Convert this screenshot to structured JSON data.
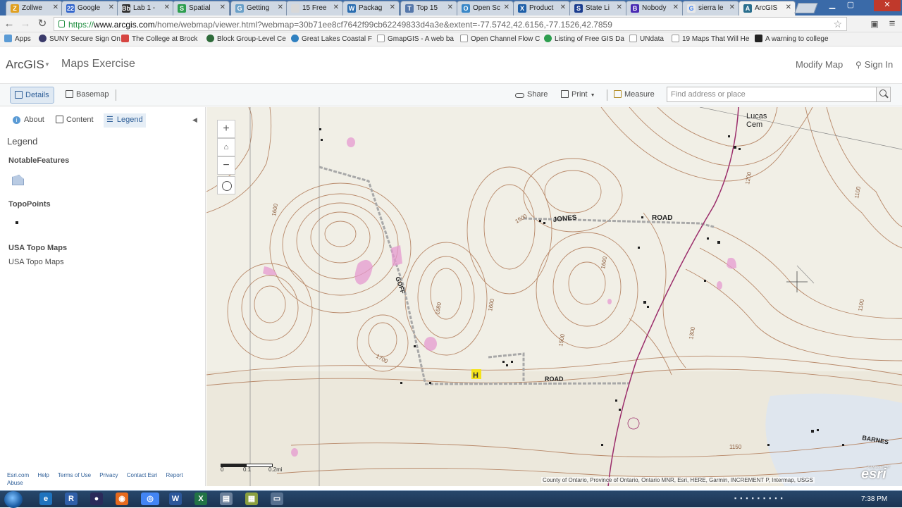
{
  "browser": {
    "tabs": [
      {
        "title": "Zollwe",
        "fav": "Z",
        "color": "#e0a020"
      },
      {
        "title": "Google",
        "fav": "22",
        "color": "#3366cc"
      },
      {
        "title": "Lab 1 -",
        "fav": "Bb",
        "color": "#333333"
      },
      {
        "title": "Spatial",
        "fav": "S",
        "color": "#2e9e4f"
      },
      {
        "title": "Getting",
        "fav": "G",
        "color": "#6aa0c8"
      },
      {
        "title": "15 Free",
        "fav": "",
        "color": "#d8d8d8"
      },
      {
        "title": "Packag",
        "fav": "W",
        "color": "#2a6db0"
      },
      {
        "title": "Top 15",
        "fav": "T",
        "color": "#5577aa"
      },
      {
        "title": "Open Sc",
        "fav": "O",
        "color": "#3a88c8"
      },
      {
        "title": "Product",
        "fav": "X",
        "color": "#1e5fa8"
      },
      {
        "title": "State Li",
        "fav": "S",
        "color": "#1b3d8f"
      },
      {
        "title": "Nobody",
        "fav": "B",
        "color": "#4b2bb3"
      },
      {
        "title": "sierra le",
        "fav": "G",
        "color": "#e8e8e8"
      },
      {
        "title": "ArcGIS",
        "fav": "A",
        "color": "#2b6f8e"
      }
    ],
    "url": {
      "scheme": "https://",
      "host": "www.arcgis.com",
      "path": "/home/webmap/viewer.html?webmap=30b71ee8cf7642f99cb62249833d4a3e&extent=-77.5742,42.6156,-77.1526,42.7859"
    },
    "bookmarks": [
      {
        "label": "Apps",
        "color": "#5b9bd5"
      },
      {
        "label": "SUNY Secure Sign On",
        "color": "#3a3a6a"
      },
      {
        "label": "The College at Brock",
        "color": "#d64541"
      },
      {
        "label": "Block Group-Level Ce",
        "color": "#2e6b3a"
      },
      {
        "label": "Great Lakes Coastal F",
        "color": "#2f80c0"
      },
      {
        "label": "GmapGIS - A web ba",
        "color": "#e0e0e0"
      },
      {
        "label": "Open Channel Flow C",
        "color": "#e0e0e0"
      },
      {
        "label": "Listing of Free GIS Da",
        "color": "#2e9e4f"
      },
      {
        "label": "UNdata",
        "color": "#e0e0e0"
      },
      {
        "label": "19 Maps That Will He",
        "color": "#e0e0e0"
      },
      {
        "label": "A warning to college",
        "color": "#222222"
      }
    ]
  },
  "app": {
    "brand": "ArcGIS",
    "map_title": "Maps Exercise",
    "modify_map": "Modify Map",
    "sign_in": "Sign In"
  },
  "toolbar": {
    "details": "Details",
    "basemap": "Basemap",
    "share": "Share",
    "print": "Print",
    "measure": "Measure",
    "search_placeholder": "Find address or place"
  },
  "panel": {
    "tabs": {
      "about": "About",
      "content": "Content",
      "legend": "Legend"
    },
    "heading": "Legend",
    "layers": [
      {
        "name": "NotableFeatures",
        "symbol": "polygon"
      },
      {
        "name": "TopoPoints",
        "symbol": "point"
      },
      {
        "name": "USA Topo Maps",
        "sublabel": "USA Topo Maps"
      }
    ],
    "footer": [
      "Esri.com",
      "Help",
      "Terms of Use",
      "Privacy",
      "Contact Esri",
      "Report Abuse"
    ]
  },
  "map": {
    "labels": {
      "lucas": "Lucas",
      "cem": "Cem",
      "jones": "JONES",
      "road1": "ROAD",
      "goff": "GOFF",
      "road2": "ROAD",
      "barnes": "BARNES",
      "c1500": "1500",
      "c1600": "1600",
      "c1680": "1680",
      "c1700": "1700",
      "c1200": "1200",
      "c1150": "1150",
      "c1100": "1100",
      "c1300": "1300",
      "marker": "H"
    },
    "scale": {
      "left": "0",
      "mid": "0.1",
      "right": "0.2mi"
    },
    "attribution": "County of Ontario, Province of Ontario, Ontario MNR, Esri, HERE, Garmin, INCREMENT P, Intermap, USGS",
    "esri_powered": "POWERED BY",
    "esri_logo": "esri"
  },
  "taskbar": {
    "clock": "7:38 PM"
  },
  "colors": {
    "accent": "#2f5f98",
    "contour": "#b8896a",
    "road": "#a8a8a8",
    "highway": "#9b2d6b",
    "feature": "#e59ad0"
  }
}
